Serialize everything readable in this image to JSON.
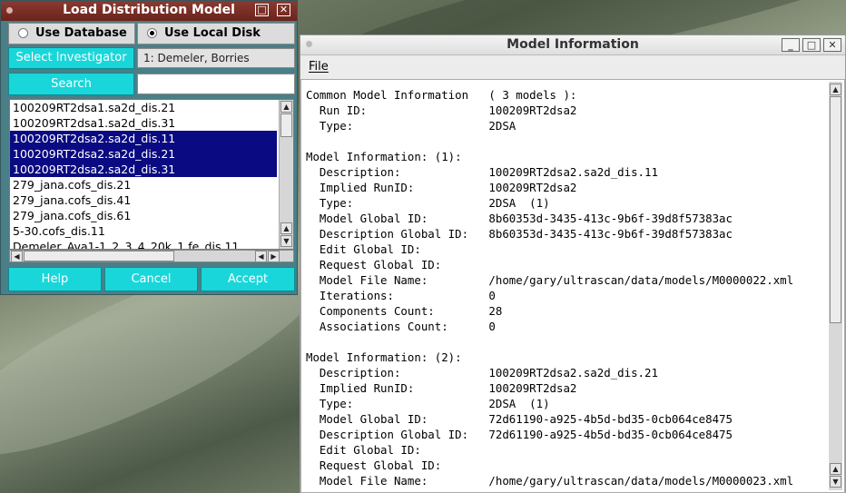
{
  "load_dialog": {
    "title": "Load Distribution Model",
    "maximize_glyph": "□",
    "close_glyph": "✕",
    "radio_database": "Use Database",
    "radio_disk": "Use Local Disk",
    "select_investigator_label": "Select Investigator",
    "investigator_value": "1: Demeler, Borries",
    "search_label": "Search",
    "search_value": "",
    "models": [
      {
        "name": "100209RT2dsa1.sa2d_dis.21",
        "selected": false
      },
      {
        "name": "100209RT2dsa1.sa2d_dis.31",
        "selected": false
      },
      {
        "name": "100209RT2dsa2.sa2d_dis.11",
        "selected": true
      },
      {
        "name": "100209RT2dsa2.sa2d_dis.21",
        "selected": true
      },
      {
        "name": "100209RT2dsa2.sa2d_dis.31",
        "selected": true
      },
      {
        "name": "279_jana.cofs_dis.21",
        "selected": false
      },
      {
        "name": "279_jana.cofs_dis.41",
        "selected": false
      },
      {
        "name": "279_jana.cofs_dis.61",
        "selected": false
      },
      {
        "name": "5-30.cofs_dis.11",
        "selected": false
      },
      {
        "name": "Demeler_Ava1-1_2_3_4_20k_1.fe_dis.11",
        "selected": false
      }
    ],
    "help_label": "Help",
    "cancel_label": "Cancel",
    "accept_label": "Accept",
    "selection_color": "#0a0a82",
    "button_color": "#19d6da"
  },
  "info_window": {
    "title": "Model Information",
    "minimize_glyph": "_",
    "maximize_glyph": "□",
    "close_glyph": "✕",
    "menu_file": "File",
    "lines": [
      "Common Model Information   ( 3 models ):",
      "  Run ID:                  100209RT2dsa2",
      "  Type:                    2DSA",
      "",
      "Model Information: (1):",
      "  Description:             100209RT2dsa2.sa2d_dis.11",
      "  Implied RunID:           100209RT2dsa2",
      "  Type:                    2DSA  (1)",
      "  Model Global ID:         8b60353d-3435-413c-9b6f-39d8f57383ac",
      "  Description Global ID:   8b60353d-3435-413c-9b6f-39d8f57383ac",
      "  Edit Global ID:",
      "  Request Global ID:",
      "  Model File Name:         /home/gary/ultrascan/data/models/M0000022.xml",
      "  Iterations:              0",
      "  Components Count:        28",
      "  Associations Count:      0",
      "",
      "Model Information: (2):",
      "  Description:             100209RT2dsa2.sa2d_dis.21",
      "  Implied RunID:           100209RT2dsa2",
      "  Type:                    2DSA  (1)",
      "  Model Global ID:         72d61190-a925-4b5d-bd35-0cb064ce8475",
      "  Description Global ID:   72d61190-a925-4b5d-bd35-0cb064ce8475",
      "  Edit Global ID:",
      "  Request Global ID:",
      "  Model File Name:         /home/gary/ultrascan/data/models/M0000023.xml"
    ]
  }
}
